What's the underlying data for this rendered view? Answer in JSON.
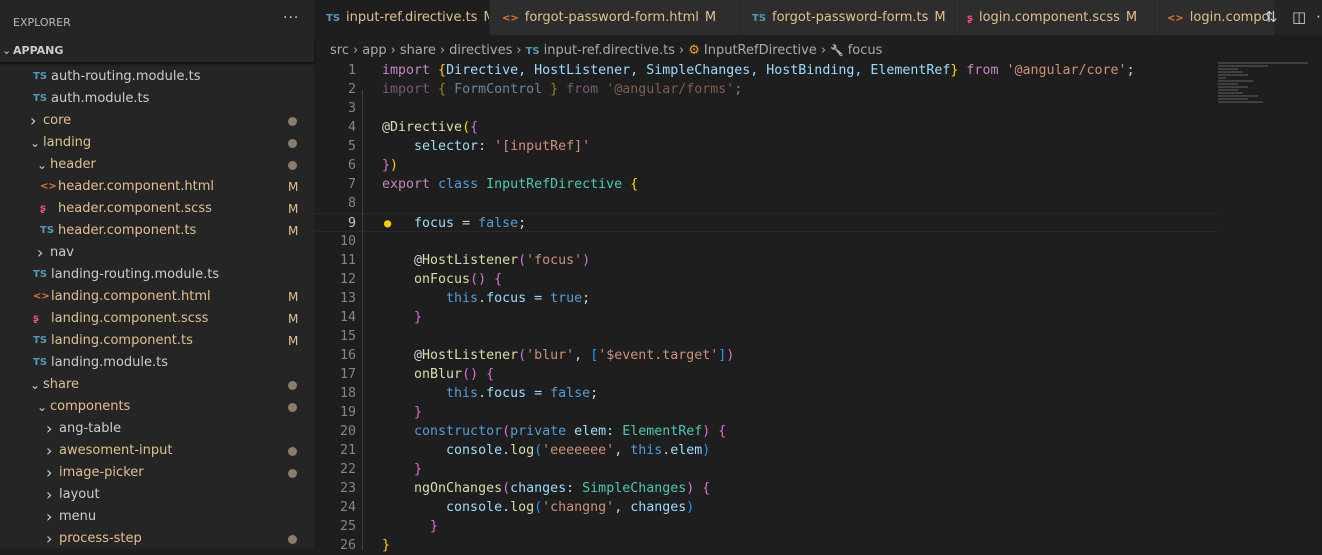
{
  "sidebar": {
    "title": "EXPLORER",
    "more": "···",
    "root": "APPANG",
    "items": [
      {
        "label": "auth-routing.module.ts",
        "type": "ts",
        "indent": 33
      },
      {
        "label": "auth.module.ts",
        "type": "ts",
        "indent": 33
      },
      {
        "label": "core",
        "type": "folder",
        "open": false,
        "indent": 30,
        "modified": true
      },
      {
        "label": "landing",
        "type": "folder",
        "open": true,
        "indent": 30,
        "modified": true
      },
      {
        "label": "header",
        "type": "folder",
        "open": true,
        "indent": 37,
        "modified": true
      },
      {
        "label": "header.component.html",
        "type": "html",
        "indent": 40,
        "badge": "M"
      },
      {
        "label": "header.component.scss",
        "type": "scss",
        "indent": 40,
        "badge": "M"
      },
      {
        "label": "header.component.ts",
        "type": "ts",
        "indent": 40,
        "badge": "M"
      },
      {
        "label": "nav",
        "type": "folder",
        "open": false,
        "indent": 37
      },
      {
        "label": "landing-routing.module.ts",
        "type": "ts",
        "indent": 33
      },
      {
        "label": "landing.component.html",
        "type": "html",
        "indent": 33,
        "badge": "M"
      },
      {
        "label": "landing.component.scss",
        "type": "scss",
        "indent": 33,
        "badge": "M"
      },
      {
        "label": "landing.component.ts",
        "type": "ts",
        "indent": 33,
        "badge": "M"
      },
      {
        "label": "landing.module.ts",
        "type": "ts",
        "indent": 33
      },
      {
        "label": "share",
        "type": "folder",
        "open": true,
        "indent": 30,
        "modified": true
      },
      {
        "label": "components",
        "type": "folder",
        "open": true,
        "indent": 37,
        "modified": true
      },
      {
        "label": "ang-table",
        "type": "folder",
        "open": false,
        "indent": 46
      },
      {
        "label": "awesoment-input",
        "type": "folder",
        "open": false,
        "indent": 46,
        "modified": true
      },
      {
        "label": "image-picker",
        "type": "folder",
        "open": false,
        "indent": 46,
        "modified": true
      },
      {
        "label": "layout",
        "type": "folder",
        "open": false,
        "indent": 46
      },
      {
        "label": "menu",
        "type": "folder",
        "open": false,
        "indent": 46
      },
      {
        "label": "process-step",
        "type": "folder",
        "open": false,
        "indent": 46,
        "modified": true
      }
    ]
  },
  "icons": {
    "ts": "TS",
    "html": "<>",
    "scss": "ʂ"
  },
  "colors": {
    "ts": "#519aba",
    "html": "#e37933",
    "scss": "#f55385",
    "modified": "#e2c08d",
    "plain": "#cccccc"
  },
  "tabs": [
    {
      "label": "input-ref.directive.ts",
      "type": "ts",
      "badge": "M",
      "active": true,
      "close": "✕"
    },
    {
      "label": "forgot-password-form.html",
      "type": "html",
      "badge": "M"
    },
    {
      "label": "forgot-password-form.ts",
      "type": "ts",
      "badge": "M"
    },
    {
      "label": "login.component.scss",
      "type": "scss",
      "badge": "M"
    },
    {
      "label": "login.compo",
      "type": "html"
    }
  ],
  "breadcrumb": [
    "src",
    "app",
    "share",
    "directives",
    "input-ref.directive.ts",
    "InputRefDirective",
    "focus"
  ],
  "code": {
    "current_line": 9,
    "lines": [
      [
        [
          "import ",
          "ctl"
        ],
        [
          "{",
          "b1"
        ],
        [
          "Directive, HostListener, SimpleChanges, HostBinding, ElementRef",
          "var"
        ],
        [
          "}",
          "b1"
        ],
        [
          " from ",
          "ctl"
        ],
        [
          "'@angular/core'",
          "str"
        ],
        [
          ";",
          "pl"
        ]
      ],
      [
        [
          "import ",
          "ctl dim"
        ],
        [
          "{",
          "b1 dim"
        ],
        [
          " FormControl ",
          "var dim"
        ],
        [
          "}",
          "b1 dim"
        ],
        [
          " from ",
          "ctl dim"
        ],
        [
          "'@angular/forms'",
          "str dim"
        ],
        [
          ";",
          "pl dim"
        ]
      ],
      [],
      [
        [
          "@",
          "pl"
        ],
        [
          "Directive",
          "fn"
        ],
        [
          "(",
          "b1"
        ],
        [
          "{",
          "b2"
        ]
      ],
      [
        [
          "    selector: ",
          "var"
        ],
        [
          "'[inputRef]'",
          "str"
        ]
      ],
      [
        [
          "}",
          "b2"
        ],
        [
          ")",
          "b1"
        ]
      ],
      [
        [
          "export ",
          "ctl"
        ],
        [
          "class ",
          "kw"
        ],
        [
          "InputRefDirective ",
          "cls"
        ],
        [
          "{",
          "b1"
        ]
      ],
      [],
      [
        [
          "    focus",
          "var"
        ],
        [
          " = ",
          "pl"
        ],
        [
          "false",
          "kw"
        ],
        [
          ";",
          "pl"
        ]
      ],
      [],
      [
        [
          "    @",
          "pl"
        ],
        [
          "HostListener",
          "fn"
        ],
        [
          "(",
          "b2"
        ],
        [
          "'focus'",
          "str"
        ],
        [
          ")",
          "b2"
        ]
      ],
      [
        [
          "    onFocus",
          "fn"
        ],
        [
          "()",
          "b2"
        ],
        [
          " ",
          "pl"
        ],
        [
          "{",
          "b2"
        ]
      ],
      [
        [
          "        this",
          "kw"
        ],
        [
          ".focus = ",
          "var"
        ],
        [
          "true",
          "kw"
        ],
        [
          ";",
          "pl"
        ]
      ],
      [
        [
          "    }",
          "b2"
        ]
      ],
      [],
      [
        [
          "    @",
          "pl"
        ],
        [
          "HostListener",
          "fn"
        ],
        [
          "(",
          "b2"
        ],
        [
          "'blur'",
          "str"
        ],
        [
          ", ",
          "pl"
        ],
        [
          "[",
          "b3"
        ],
        [
          "'$event.target'",
          "str"
        ],
        [
          "]",
          "b3"
        ],
        [
          ")",
          "b2"
        ]
      ],
      [
        [
          "    onBlur",
          "fn"
        ],
        [
          "()",
          "b2"
        ],
        [
          " ",
          "pl"
        ],
        [
          "{",
          "b2"
        ]
      ],
      [
        [
          "        this",
          "kw"
        ],
        [
          ".focus = ",
          "var"
        ],
        [
          "false",
          "kw"
        ],
        [
          ";",
          "pl"
        ]
      ],
      [
        [
          "    }",
          "b2"
        ]
      ],
      [
        [
          "    constructor",
          "kw"
        ],
        [
          "(",
          "b2"
        ],
        [
          "private ",
          "kw"
        ],
        [
          "elem: ",
          "var"
        ],
        [
          "ElementRef",
          "cls"
        ],
        [
          ")",
          "b2"
        ],
        [
          " ",
          "pl"
        ],
        [
          "{",
          "b2"
        ]
      ],
      [
        [
          "        console.",
          "var"
        ],
        [
          "log",
          "fn"
        ],
        [
          "(",
          "b3"
        ],
        [
          "'eeeeeee'",
          "str"
        ],
        [
          ", ",
          "pl"
        ],
        [
          "this",
          "kw"
        ],
        [
          ".elem",
          "var"
        ],
        [
          ")",
          "b3"
        ]
      ],
      [
        [
          "    }",
          "b2"
        ]
      ],
      [
        [
          "    ngOnChanges",
          "fn"
        ],
        [
          "(",
          "b2"
        ],
        [
          "changes: ",
          "var"
        ],
        [
          "SimpleChanges",
          "cls"
        ],
        [
          ")",
          "b2"
        ],
        [
          " ",
          "pl"
        ],
        [
          "{",
          "b2"
        ]
      ],
      [
        [
          "        console.",
          "var"
        ],
        [
          "log",
          "fn"
        ],
        [
          "(",
          "b3"
        ],
        [
          "'changng'",
          "str"
        ],
        [
          ", changes",
          "var"
        ],
        [
          ")",
          "b3"
        ]
      ],
      [
        [
          "      }",
          "b2"
        ]
      ],
      [
        [
          "}",
          "b1"
        ]
      ]
    ]
  }
}
